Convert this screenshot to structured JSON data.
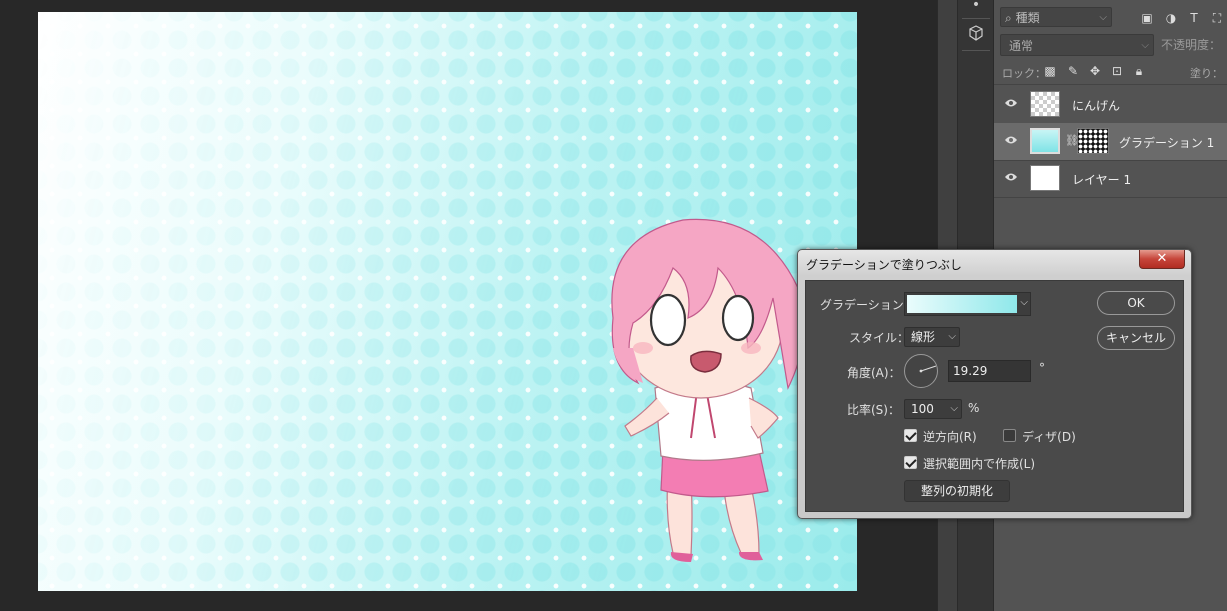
{
  "layers_panel": {
    "kind_filter": "種類",
    "blend_mode": "通常",
    "opacity_label": "不透明度：",
    "lock_label": "ロック：",
    "fill_label": "塗り：",
    "layers": [
      {
        "name": "にんげん",
        "visible": true,
        "selected": false
      },
      {
        "name": "グラデーション 1",
        "visible": true,
        "selected": true
      },
      {
        "name": "レイヤー 1",
        "visible": true,
        "selected": false
      }
    ]
  },
  "dialog": {
    "title": "グラデーションで塗りつぶし",
    "close_label": "✕",
    "gradient_label": "グラデーション：",
    "gradient_colors": [
      "#eafcfc",
      "#8fe8ea"
    ],
    "style_label": "スタイル：",
    "style_value": "線形",
    "angle_label": "角度(A)：",
    "angle_value": "19.29",
    "angle_unit": "°",
    "scale_label": "比率(S)：",
    "scale_value": "100",
    "scale_unit": "%",
    "reverse_label": "逆方向(R)",
    "reverse_checked": true,
    "dither_label": "ディザ(D)",
    "dither_checked": false,
    "align_label": "選択範囲内で作成(L)",
    "align_checked": true,
    "reset_alignment_label": "整列の初期化",
    "ok_label": "OK",
    "cancel_label": "キャンセル"
  },
  "colors": {
    "canvas_gradient_light": "#ffffff",
    "canvas_gradient_cyan": "#9aebeb",
    "dialog_close": "#c6453a"
  }
}
